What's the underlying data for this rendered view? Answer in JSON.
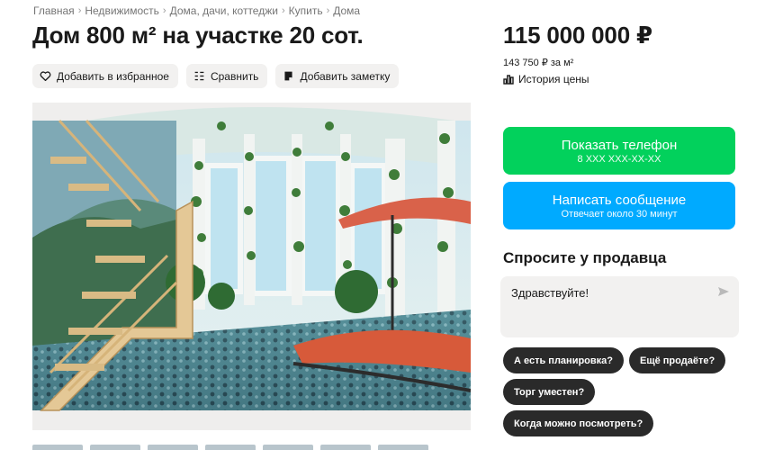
{
  "breadcrumbs": [
    "Главная",
    "Недвижимость",
    "Дома, дачи, коттеджи",
    "Купить",
    "Дома"
  ],
  "listing": {
    "title": "Дом 800 м² на участке 20 сот.",
    "price": "115 000 000 ₽",
    "price_per_sqm": "143 750 ₽ за м²",
    "price_history_label": "История цены"
  },
  "actions": {
    "favorite_label": "Добавить в избранное",
    "compare_label": "Сравнить",
    "note_label": "Добавить заметку"
  },
  "cta": {
    "phone_label": "Показать телефон",
    "phone_masked": "8 XXX XXX-XX-XX",
    "message_label": "Написать сообщение",
    "message_sub": "Отвечает около 30 минут"
  },
  "ask_seller": {
    "title": "Спросите у продавца",
    "input_value": "Здравствуйте!",
    "chips": [
      "А есть планировка?",
      "Ещё продаёте?",
      "Торг уместен?",
      "Когда можно посмотреть?"
    ]
  },
  "colors": {
    "phone_button": "#02d15c",
    "message_button": "#00aaff",
    "chip_bg": "#2a2a2a",
    "action_bg": "#f2f1f0"
  },
  "icons": [
    "heart-icon",
    "compare-icon",
    "note-icon",
    "chart-icon",
    "send-icon",
    "chevron-right-icon"
  ]
}
